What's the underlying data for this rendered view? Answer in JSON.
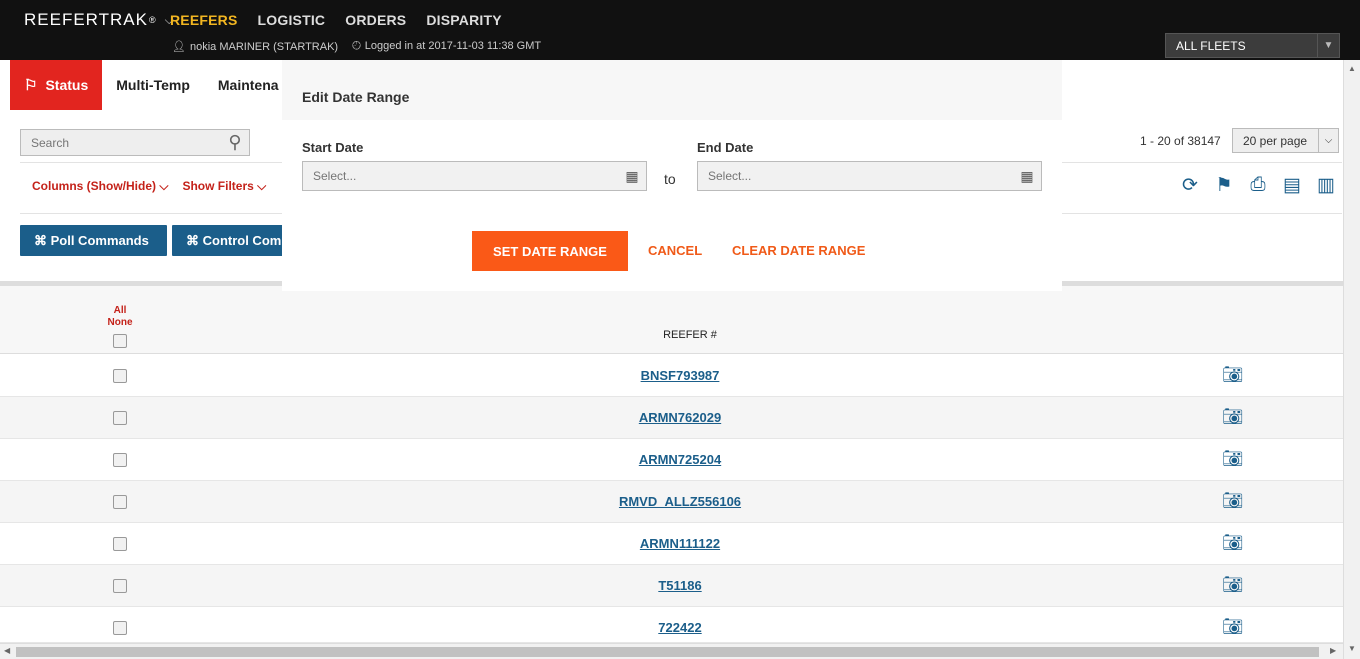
{
  "app": {
    "brand": "REEFERTRAK",
    "brand_mark": "®",
    "nav": [
      "REEFERS",
      "LOGISTIC",
      "ORDERS",
      "DISPARITY"
    ],
    "user": "nokia MARINER (STARTRAK)",
    "login_info": "Logged in at 2017-11-03 11:38 GMT",
    "fleet_select": "ALL FLEETS"
  },
  "tabs": [
    "Status",
    "Multi-Temp",
    "Maintena"
  ],
  "toolbar": {
    "search_placeholder": "Search",
    "columns_label": "Columns (Show/Hide)",
    "filters_label": "Show Filters",
    "poll_commands": "⌘ Poll Commands",
    "control_commands": "⌘ Control Com",
    "pagination": "1 - 20 of 38147",
    "per_page": "20 per page"
  },
  "grid": {
    "all_label": "All",
    "none_label": "None",
    "column_header": "REEFER #",
    "rows": [
      "BNSF793987",
      "ARMN762029",
      "ARMN725204",
      "RMVD_ALLZ556106",
      "ARMN111122",
      "T51186",
      "722422"
    ]
  },
  "modal": {
    "title": "Edit Date Range",
    "start_label": "Start Date",
    "end_label": "End Date",
    "start_placeholder": "Select...",
    "end_placeholder": "Select...",
    "to_text": "to",
    "set_button": "SET DATE RANGE",
    "cancel_button": "CANCEL",
    "clear_button": "CLEAR DATE RANGE"
  },
  "colors": {
    "accent_red": "#e2251f",
    "nav_active": "#f2b621",
    "link_blue": "#1b5e8a",
    "action_orange": "#fa5917"
  }
}
